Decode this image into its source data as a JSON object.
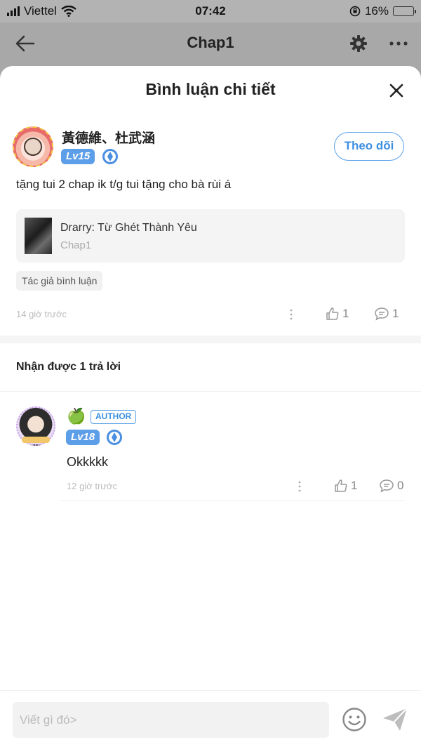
{
  "status_bar": {
    "carrier": "Viettel",
    "time": "07:42",
    "battery": "16%",
    "battery_level": 0.16
  },
  "header": {
    "title": "Chap1",
    "back_icon": "back-arrow-icon",
    "settings_icon": "gear-icon",
    "more_icon": "more-dots-icon"
  },
  "sheet": {
    "title": "Bình luận chi tiết",
    "close_icon": "close-icon"
  },
  "comment": {
    "author_name": "黃德維、杜武涵",
    "level": "Lv15",
    "follow_label": "Theo dõi",
    "text": "tặng tui 2 chap ik t/g tui tặng cho bà rùi á",
    "chapter": {
      "name": "Drarry: Từ Ghét Thành Yêu",
      "sub": "Chap1"
    },
    "tag": "Tác giả bình luận",
    "time": "14 giờ trước",
    "likes": "1",
    "replies": "1"
  },
  "replies_header": "Nhận được 1 trả lời",
  "reply": {
    "emoji": "🍏",
    "author_badge": "AUTHOR",
    "level": "Lv18",
    "text": "Okkkkk",
    "time": "12 giờ trước",
    "likes": "1",
    "replies": "0"
  },
  "input": {
    "placeholder": "Viết gì đó>",
    "emoji_icon": "emoji-icon",
    "send_icon": "send-icon"
  },
  "colors": {
    "accent": "#3d8fe0",
    "level_badge": "#5d9ee8"
  }
}
